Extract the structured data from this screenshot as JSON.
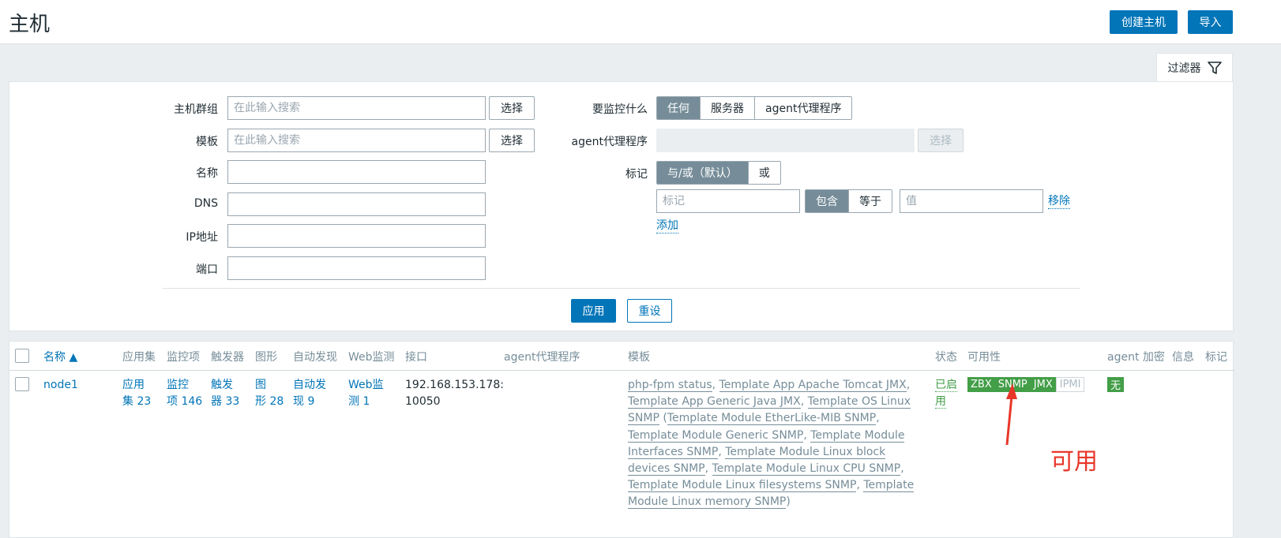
{
  "header": {
    "title": "主机",
    "create_button": "创建主机",
    "import_button": "导入"
  },
  "filter_tab": {
    "label": "过滤器",
    "icon": "funnel-icon"
  },
  "filter": {
    "host_group": {
      "label": "主机群组",
      "placeholder": "在此输入搜索",
      "button": "选择"
    },
    "template": {
      "label": "模板",
      "placeholder": "在此输入搜索",
      "button": "选择"
    },
    "name": {
      "label": "名称",
      "value": ""
    },
    "dns": {
      "label": "DNS",
      "value": ""
    },
    "ip": {
      "label": "IP地址",
      "value": ""
    },
    "port": {
      "label": "端口",
      "value": ""
    },
    "monitored_by": {
      "label": "要监控什么",
      "options": [
        "任何",
        "服务器",
        "agent代理程序"
      ],
      "selected": "任何"
    },
    "proxy": {
      "label": "agent代理程序",
      "button": "选择"
    },
    "tags": {
      "label": "标记",
      "operator_options": [
        "与/或（默认）",
        "或"
      ],
      "operator_selected": "与/或（默认）",
      "tag_placeholder": "标记",
      "match_options": [
        "包含",
        "等于"
      ],
      "match_selected": "包含",
      "value_placeholder": "值",
      "remove_link": "移除",
      "add_link": "添加"
    },
    "apply_button": "应用",
    "reset_button": "重设"
  },
  "table": {
    "columns": [
      "名称 ▲",
      "应用集",
      "监控项",
      "触发器",
      "图形",
      "自动发现",
      "Web监测",
      "接口",
      "agent代理程序",
      "模板",
      "状态",
      "可用性",
      "agent 加密",
      "信息",
      "标记"
    ],
    "rows": [
      {
        "name": "node1",
        "applications": [
          "应用",
          "集 23"
        ],
        "items": [
          "监控",
          "项 146"
        ],
        "triggers": [
          "触发",
          "器 33"
        ],
        "graphs": [
          "图",
          "形 28"
        ],
        "discovery": [
          "自动发",
          "现 9"
        ],
        "web": [
          "Web监",
          "测 1"
        ],
        "interface": [
          "192.168.153.178:",
          "10050"
        ],
        "proxy": "",
        "templates": {
          "main": [
            "php-fpm status",
            "Template App Apache Tomcat JMX",
            "Template App Generic Java JMX",
            "Template OS Linux SNMP"
          ],
          "nested": [
            "Template Module EtherLike-MIB SNMP",
            "Template Module Generic SNMP",
            "Template Module Interfaces SNMP",
            "Template Module Linux block devices SNMP",
            "Template Module Linux CPU SNMP",
            "Template Module Linux filesystems SNMP",
            "Template Module Linux memory SNMP"
          ]
        },
        "status": [
          "已启",
          "用"
        ],
        "availability": [
          {
            "label": "ZBX",
            "state": "available",
            "color": "#429e47"
          },
          {
            "label": "SNMP",
            "state": "available",
            "color": "#429e47"
          },
          {
            "label": "JMX",
            "state": "available",
            "color": "#429e47"
          },
          {
            "label": "IPMI",
            "state": "unknown",
            "color": "#acbbc2"
          }
        ],
        "encryption": "无"
      }
    ]
  },
  "annotation": {
    "text": "可用",
    "color": "#e8372a"
  },
  "colors": {
    "accent": "#0275b8",
    "available": "#429e47",
    "annotation": "#e8372a"
  }
}
